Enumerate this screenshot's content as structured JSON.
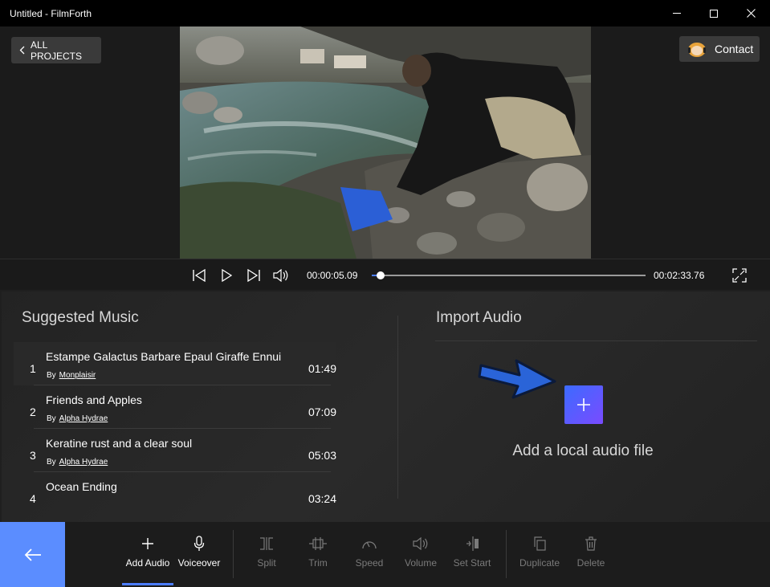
{
  "window": {
    "title": "Untitled - FilmForth",
    "controls": [
      "minimize-icon",
      "maximize-icon",
      "close-icon"
    ]
  },
  "header": {
    "back_label": "ALL PROJECTS",
    "contact_label": "Contact"
  },
  "player": {
    "current_time": "00:00:05.09",
    "total_time": "00:02:33.76",
    "progress_fraction": 0.033,
    "buttons": [
      "skip-back-icon",
      "play-icon",
      "skip-forward-icon",
      "volume-icon",
      "fullscreen-icon"
    ]
  },
  "suggested_music": {
    "title": "Suggested Music",
    "by_prefix": "By",
    "items": [
      {
        "num": "1",
        "name": "Estampe Galactus Barbare Epaul Giraffe Ennui",
        "artist": "Monplaisir",
        "duration": "01:49"
      },
      {
        "num": "2",
        "name": "Friends and Apples",
        "artist": "Alpha Hydrae",
        "duration": "07:09"
      },
      {
        "num": "3",
        "name": "Keratine rust and a clear soul",
        "artist": "Alpha Hydrae",
        "duration": "05:03"
      },
      {
        "num": "4",
        "name": "Ocean Ending",
        "artist": "",
        "duration": "03:24"
      }
    ]
  },
  "import_audio": {
    "title": "Import Audio",
    "add_label": "Add a local audio file"
  },
  "toolbar": {
    "tools": [
      {
        "label": "Add Audio",
        "icon": "plus-icon",
        "enabled": true,
        "active": true
      },
      {
        "label": "Voiceover",
        "icon": "microphone-icon",
        "enabled": true
      },
      {
        "label": "Split",
        "icon": "split-icon",
        "enabled": false
      },
      {
        "label": "Trim",
        "icon": "trim-icon",
        "enabled": false
      },
      {
        "label": "Speed",
        "icon": "speed-icon",
        "enabled": false
      },
      {
        "label": "Volume",
        "icon": "volume-icon",
        "enabled": false
      },
      {
        "label": "Set Start",
        "icon": "set-start-icon",
        "enabled": false
      },
      {
        "label": "Duplicate",
        "icon": "duplicate-icon",
        "enabled": false
      },
      {
        "label": "Delete",
        "icon": "trash-icon",
        "enabled": false
      }
    ]
  },
  "colors": {
    "accent": "#4c7dff",
    "back_button": "#5b8dff",
    "add_button_gradient": [
      "#3c6bff",
      "#7a4bff"
    ]
  }
}
